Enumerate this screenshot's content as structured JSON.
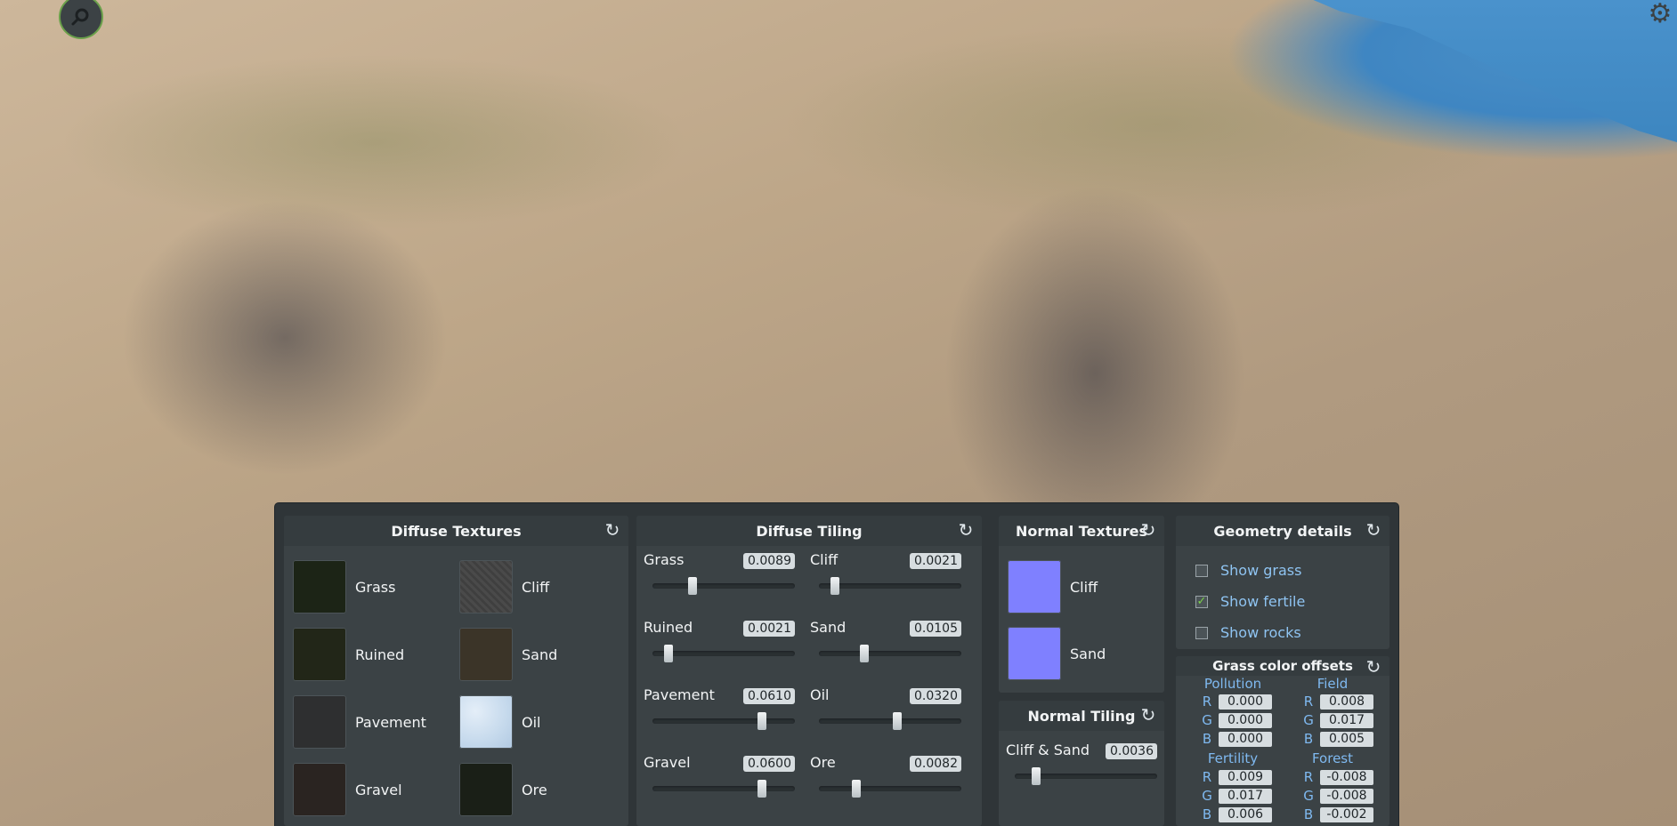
{
  "icons": {
    "magnifier": "magnifier-icon",
    "gear": "gear-icon",
    "reset": "reset-icon"
  },
  "diffuse_textures": {
    "title": "Diffuse Textures",
    "items": [
      {
        "label": "Grass",
        "color": "#1c2416"
      },
      {
        "label": "Cliff",
        "color": "#4a4a4a"
      },
      {
        "label": "Ruined",
        "color": "#222618"
      },
      {
        "label": "Sand",
        "color": "#3b3428"
      },
      {
        "label": "Pavement",
        "color": "#2e2f30"
      },
      {
        "label": "Oil",
        "color": "#c5d9ec"
      },
      {
        "label": "Gravel",
        "color": "#2a2421"
      },
      {
        "label": "Ore",
        "color": "#1a1f17"
      }
    ]
  },
  "diffuse_tiling": {
    "title": "Diffuse Tiling",
    "items": [
      {
        "label": "Grass",
        "value": "0.0089",
        "level": 0.28
      },
      {
        "label": "Cliff",
        "value": "0.0021",
        "level": 0.11
      },
      {
        "label": "Ruined",
        "value": "0.0021",
        "level": 0.11
      },
      {
        "label": "Sand",
        "value": "0.0105",
        "level": 0.32
      },
      {
        "label": "Pavement",
        "value": "0.0610",
        "level": 0.77
      },
      {
        "label": "Oil",
        "value": "0.0320",
        "level": 0.55
      },
      {
        "label": "Gravel",
        "value": "0.0600",
        "level": 0.77
      },
      {
        "label": "Ore",
        "value": "0.0082",
        "level": 0.26
      }
    ]
  },
  "normal_textures": {
    "title": "Normal Textures",
    "items": [
      {
        "label": "Cliff",
        "color": "#7f80ff"
      },
      {
        "label": "Sand",
        "color": "#7f80ff"
      }
    ]
  },
  "normal_tiling": {
    "title": "Normal Tiling",
    "items": [
      {
        "label": "Cliff & Sand",
        "value": "0.0036",
        "level": 0.15
      }
    ]
  },
  "geometry_details": {
    "title": "Geometry details",
    "options": [
      {
        "label": "Show grass",
        "checked": false
      },
      {
        "label": "Show fertile",
        "checked": true
      },
      {
        "label": "Show rocks",
        "checked": false
      }
    ]
  },
  "grass_color_offsets": {
    "title": "Grass color offsets",
    "groups": [
      {
        "name": "Pollution",
        "r": "0.000",
        "g": "0.000",
        "b": "0.000"
      },
      {
        "name": "Field",
        "r": "0.008",
        "g": "0.017",
        "b": "0.005"
      },
      {
        "name": "Fertility",
        "r": "0.009",
        "g": "0.017",
        "b": "0.006"
      },
      {
        "name": "Forest",
        "r": "-0.008",
        "g": "-0.008",
        "b": "-0.002"
      }
    ],
    "channels": {
      "r": "R",
      "g": "G",
      "b": "B"
    }
  }
}
